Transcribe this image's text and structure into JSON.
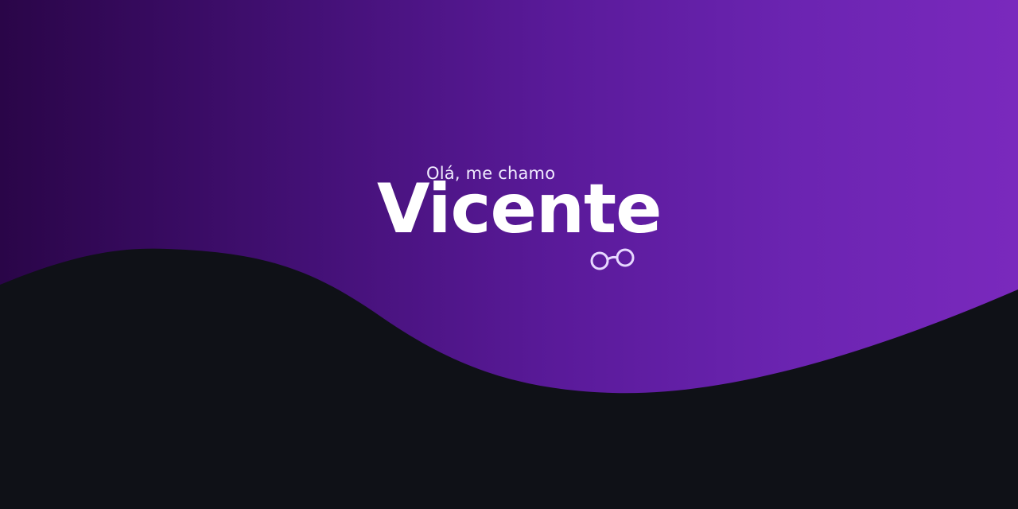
{
  "hero": {
    "greeting": "Olá, me chamo",
    "name": "Vicente",
    "decoration_icon": "glasses-icon"
  },
  "colors": {
    "background_dark": "#0f1117",
    "gradient_start": "#2a0548",
    "gradient_end": "#7a29bd",
    "text_primary": "#ffffff",
    "icon_stroke": "#e7d8ff"
  }
}
